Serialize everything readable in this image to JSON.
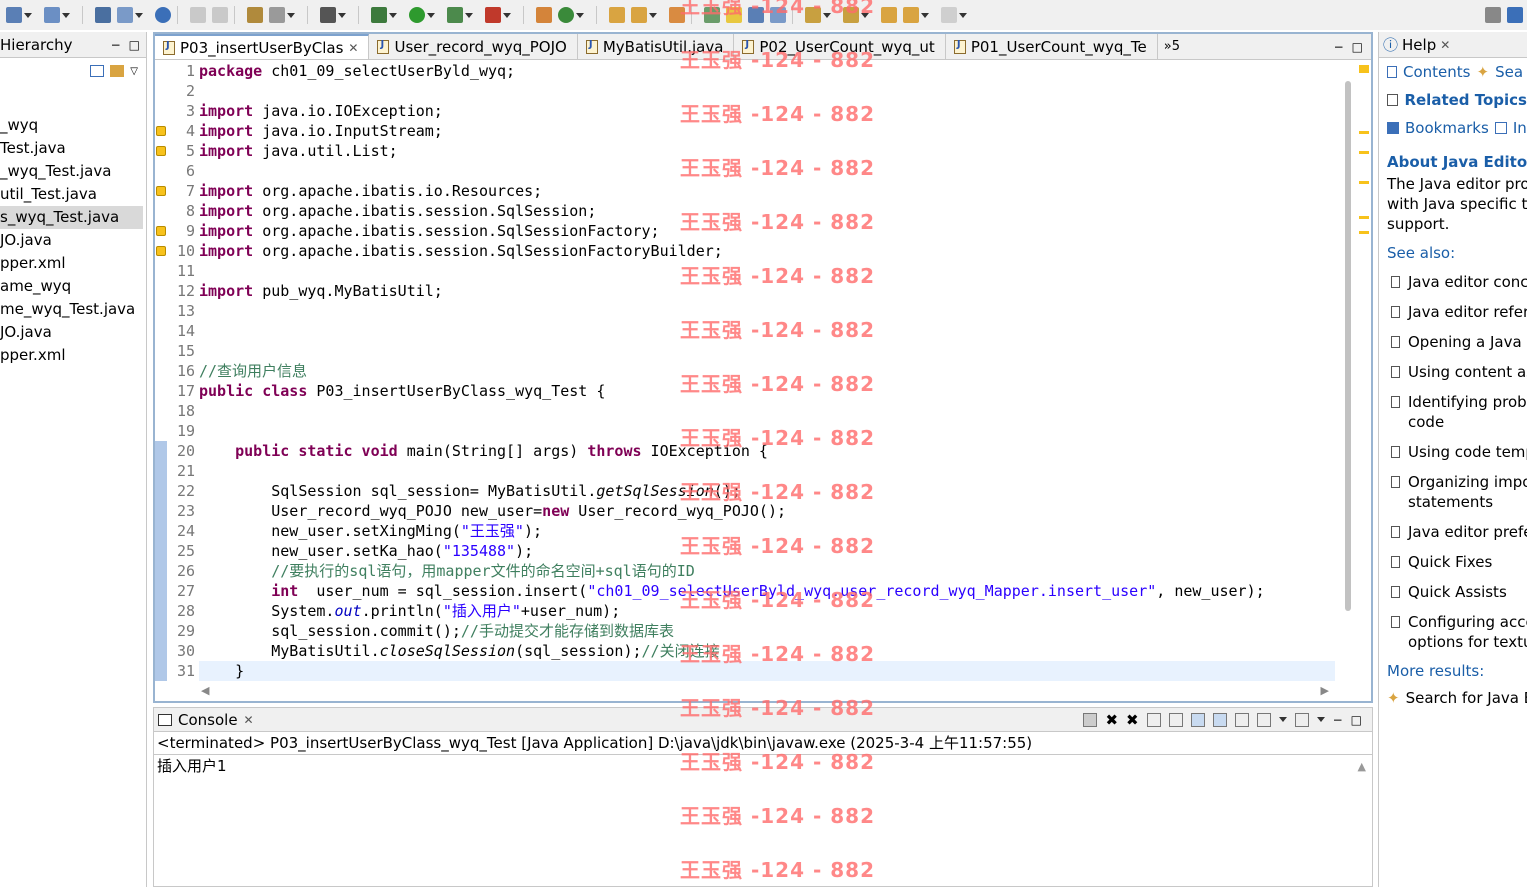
{
  "left_panel": {
    "tab_label": "Hierarchy",
    "items": [
      "_wyq",
      "Test.java",
      "_wyq_Test.java",
      "util_Test.java",
      "s_wyq_Test.java",
      "JO.java",
      "pper.xml",
      "ame_wyq",
      "me_wyq_Test.java",
      "JO.java",
      "pper.xml"
    ],
    "selected_index": 4
  },
  "editor": {
    "tabs": [
      {
        "label": "P03_insertUserByClas",
        "active": true
      },
      {
        "label": "User_record_wyq_POJO",
        "active": false
      },
      {
        "label": "MyBatisUtil.java",
        "active": false
      },
      {
        "label": "P02_UserCount_wyq_ut",
        "active": false
      },
      {
        "label": "P01_UserCount_wyq_Te",
        "active": false
      }
    ],
    "overflow_count": "5",
    "line_numbers": [
      "1",
      "2",
      "3",
      "4",
      "5",
      "6",
      "7",
      "8",
      "9",
      "10",
      "11",
      "12",
      "13",
      "14",
      "15",
      "16",
      "17",
      "18",
      "19",
      "20",
      "21",
      "22",
      "23",
      "24",
      "25",
      "26",
      "27",
      "28",
      "29",
      "30",
      "31"
    ],
    "code": {
      "l1_kw": "package",
      "l1_rest": " ch01_09_selectUserByld_wyq;",
      "l3_kw": "import",
      "l3_rest": " java.io.IOException;",
      "l4_kw": "import",
      "l4_rest": " java.io.InputStream;",
      "l5_kw": "import",
      "l5_rest": " java.util.List;",
      "l7_kw": "import",
      "l7_rest": " org.apache.ibatis.io.Resources;",
      "l8_kw": "import",
      "l8_rest": " org.apache.ibatis.session.SqlSession;",
      "l9_kw": "import",
      "l9_rest": " org.apache.ibatis.session.SqlSessionFactory;",
      "l10_kw": "import",
      "l10_rest": " org.apache.ibatis.session.SqlSessionFactoryBuilder;",
      "l12_kw": "import",
      "l12_rest": " pub_wyq.MyBatisUtil;",
      "l16_cmt": "//查询用户信息",
      "l17_kw": "public class",
      "l17_rest": " P03_insertUserByClass_wyq_Test {",
      "l20_indent": "    ",
      "l20_kw1": "public static void",
      "l20_mid": " main(String[] args) ",
      "l20_kw2": "throws",
      "l20_rest": " IOException {",
      "l22_a": "        SqlSession sql_session= MyBatisUtil.",
      "l22_it": "getSqlSession",
      "l22_b": "();",
      "l23_a": "        User_record_wyq_POJO new_user=",
      "l23_kw": "new",
      "l23_b": " User_record_wyq_POJO();",
      "l24_a": "        new_user.setXingMing(",
      "l24_str": "\"王玉强\"",
      "l24_b": ");",
      "l25_a": "        new_user.setKa_hao(",
      "l25_str": "\"135488\"",
      "l25_b": ");",
      "l26_cmt": "        //要执行的sql语句，用mapper文件的命名空间+sql语句的ID",
      "l27_indent": "        ",
      "l27_kw": "int",
      "l27_a": "  user_num = sql_session.insert(",
      "l27_str": "\"ch01_09_selectUserByld_wyq.user_record_wyq_Mapper.insert_user\"",
      "l27_b": ", new_user);",
      "l28_a": "        System.",
      "l28_it": "out",
      "l28_b": ".println(",
      "l28_str": "\"插入用户\"",
      "l28_c": "+user_num);",
      "l29_a": "        sql_session.commit();",
      "l29_cmt": "//手动提交才能存储到数据库表",
      "l30_a": "        MyBatisUtil.",
      "l30_it": "closeSqlSession",
      "l30_b": "(sql_session);",
      "l30_cmt": "//关闭连接",
      "l31": "    }"
    }
  },
  "console": {
    "tab_label": "Console",
    "status": "<terminated> P03_insertUserByClass_wyq_Test [Java Application] D:\\java\\jdk\\bin\\javaw.exe (2025-3-4 上午11:57:55)",
    "output": "插入用户1"
  },
  "help": {
    "tab_label": "Help",
    "contents": "Contents",
    "search": "Sea",
    "related_topics": "Related Topics",
    "bookmarks": "Bookmarks",
    "index": "In",
    "about_title": "About Java Editor",
    "about_text": "The Java editor provides you with Java specific text editing support.",
    "about_lines": [
      "The Java editor pro",
      "with Java specific te",
      "support."
    ],
    "see_also": "See also:",
    "links": [
      [
        "Java editor conce"
      ],
      [
        "Java editor refere"
      ],
      [
        "Opening a Java e"
      ],
      [
        "Using content as"
      ],
      [
        "Identifying probl",
        "code"
      ],
      [
        "Using code temp"
      ],
      [
        "Organizing impo",
        "statements"
      ],
      [
        "Java editor prefe"
      ],
      [
        "Quick Fixes"
      ],
      [
        "Quick Assists"
      ],
      [
        "Configuring acce",
        "options for textu"
      ]
    ],
    "more_results": "More results:",
    "search_for": "Search for Java E"
  },
  "watermark": "王玉强 -124 - 882"
}
